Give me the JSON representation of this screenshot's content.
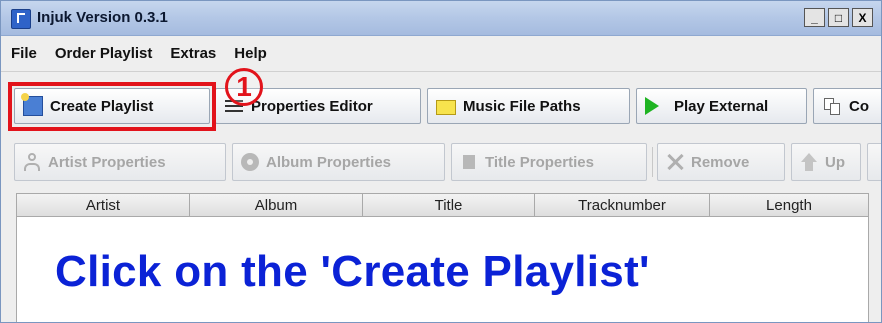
{
  "window": {
    "title": "Injuk Version 0.3.1",
    "controls": [
      "_",
      "□",
      "X"
    ]
  },
  "menu": {
    "items": [
      "File",
      "Order Playlist",
      "Extras",
      "Help"
    ]
  },
  "toolbar": {
    "buttons": [
      {
        "label": "Create Playlist",
        "icon": "create-playlist-icon"
      },
      {
        "label": "Properties Editor",
        "icon": "properties-editor-icon"
      },
      {
        "label": "Music File Paths",
        "icon": "folder-icon"
      },
      {
        "label": "Play External",
        "icon": "play-icon"
      },
      {
        "label": "Co",
        "icon": "copy-icon"
      }
    ]
  },
  "annotation": {
    "callout_number": "1",
    "highlight_color": "#e2131b"
  },
  "toolbar2": {
    "buttons": [
      {
        "label": "Artist Properties",
        "icon": "person-icon",
        "enabled": false
      },
      {
        "label": "Album Properties",
        "icon": "disc-icon",
        "enabled": false
      },
      {
        "label": "Title Properties",
        "icon": "music-note-icon",
        "enabled": false
      },
      {
        "label": "Remove",
        "icon": "remove-x-icon",
        "enabled": false
      },
      {
        "label": "Up",
        "icon": "arrow-up-icon",
        "enabled": false
      }
    ]
  },
  "table": {
    "columns": [
      "Artist",
      "Album",
      "Title",
      "Tracknumber",
      "Length"
    ]
  },
  "instruction": {
    "text": "Click on the 'Create Playlist'",
    "color": "#0b22d6"
  }
}
